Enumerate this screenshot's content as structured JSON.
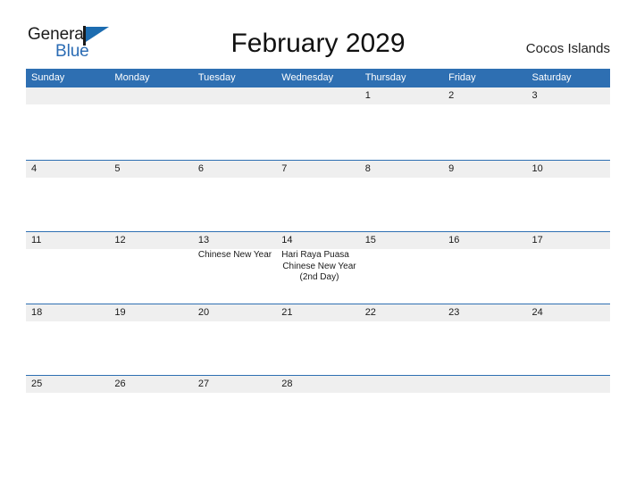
{
  "brand": {
    "name_part1": "General",
    "name_part2": "Blue",
    "flag_icon": "flag-icon",
    "accent_color": "#2b6cb4"
  },
  "header": {
    "title": "February 2029",
    "location": "Cocos Islands"
  },
  "calendar": {
    "header_bg_color": "#2e6fb2",
    "band_bg_color": "#efefef",
    "row_border_color": "#2e6fb2",
    "weekdays": [
      "Sunday",
      "Monday",
      "Tuesday",
      "Wednesday",
      "Thursday",
      "Friday",
      "Saturday"
    ],
    "weeks": [
      {
        "days": [
          {
            "number": "",
            "events": []
          },
          {
            "number": "",
            "events": []
          },
          {
            "number": "",
            "events": []
          },
          {
            "number": "",
            "events": []
          },
          {
            "number": "1",
            "events": []
          },
          {
            "number": "2",
            "events": []
          },
          {
            "number": "3",
            "events": []
          }
        ]
      },
      {
        "days": [
          {
            "number": "4",
            "events": []
          },
          {
            "number": "5",
            "events": []
          },
          {
            "number": "6",
            "events": []
          },
          {
            "number": "7",
            "events": []
          },
          {
            "number": "8",
            "events": []
          },
          {
            "number": "9",
            "events": []
          },
          {
            "number": "10",
            "events": []
          }
        ]
      },
      {
        "days": [
          {
            "number": "11",
            "events": []
          },
          {
            "number": "12",
            "events": []
          },
          {
            "number": "13",
            "events": [
              "Chinese New Year"
            ]
          },
          {
            "number": "14",
            "events": [
              "Hari Raya Puasa",
              "Chinese New Year (2nd Day)"
            ]
          },
          {
            "number": "15",
            "events": []
          },
          {
            "number": "16",
            "events": []
          },
          {
            "number": "17",
            "events": []
          }
        ]
      },
      {
        "days": [
          {
            "number": "18",
            "events": []
          },
          {
            "number": "19",
            "events": []
          },
          {
            "number": "20",
            "events": []
          },
          {
            "number": "21",
            "events": []
          },
          {
            "number": "22",
            "events": []
          },
          {
            "number": "23",
            "events": []
          },
          {
            "number": "24",
            "events": []
          }
        ]
      },
      {
        "days": [
          {
            "number": "25",
            "events": []
          },
          {
            "number": "26",
            "events": []
          },
          {
            "number": "27",
            "events": []
          },
          {
            "number": "28",
            "events": []
          },
          {
            "number": "",
            "events": []
          },
          {
            "number": "",
            "events": []
          },
          {
            "number": "",
            "events": []
          }
        ]
      }
    ]
  }
}
